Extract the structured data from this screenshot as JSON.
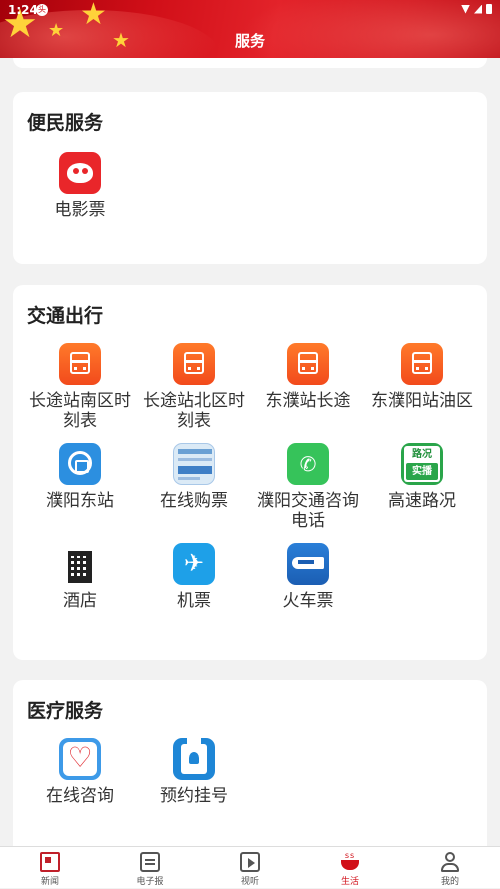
{
  "status_bar": {
    "time": "1:24",
    "notification_badge": "头"
  },
  "header": {
    "title": "服务"
  },
  "sections": [
    {
      "title": "便民服务",
      "items": [
        {
          "label": "电影票",
          "icon": "cat-eye-movie-icon"
        }
      ]
    },
    {
      "title": "交通出行",
      "items": [
        {
          "label": "长途站南区时刻表",
          "icon": "bus-icon"
        },
        {
          "label": "长途站北区时刻表",
          "icon": "bus-icon"
        },
        {
          "label": "东濮站长途",
          "icon": "bus-icon"
        },
        {
          "label": "东濮阳站油区",
          "icon": "bus-icon"
        },
        {
          "label": "濮阳东站",
          "icon": "railway-logo-icon"
        },
        {
          "label": "在线购票",
          "icon": "ticket-screen-icon"
        },
        {
          "label": "濮阳交通咨询电话",
          "icon": "phone-icon"
        },
        {
          "label": "高速路况",
          "icon": "road-condition-icon",
          "icon_text": [
            "路况",
            "实播"
          ]
        },
        {
          "label": "酒店",
          "icon": "hotel-building-icon"
        },
        {
          "label": "机票",
          "icon": "airplane-icon"
        },
        {
          "label": "火车票",
          "icon": "high-speed-train-icon"
        }
      ]
    },
    {
      "title": "医疗服务",
      "items": [
        {
          "label": "在线咨询",
          "icon": "heart-consult-icon"
        },
        {
          "label": "预约挂号",
          "icon": "doctor-register-icon"
        }
      ]
    }
  ],
  "tabbar": [
    {
      "label": "新闻",
      "icon": "news-icon",
      "active": false
    },
    {
      "label": "电子报",
      "icon": "newspaper-icon",
      "active": false
    },
    {
      "label": "视听",
      "icon": "video-icon",
      "active": false
    },
    {
      "label": "生活",
      "icon": "coffee-cup-icon",
      "active": true
    },
    {
      "label": "我的",
      "icon": "user-icon",
      "active": false
    }
  ],
  "colors": {
    "brand_red": "#d10f18",
    "bus_orange": "#f24a1c",
    "active_tab": "#d10f18"
  }
}
